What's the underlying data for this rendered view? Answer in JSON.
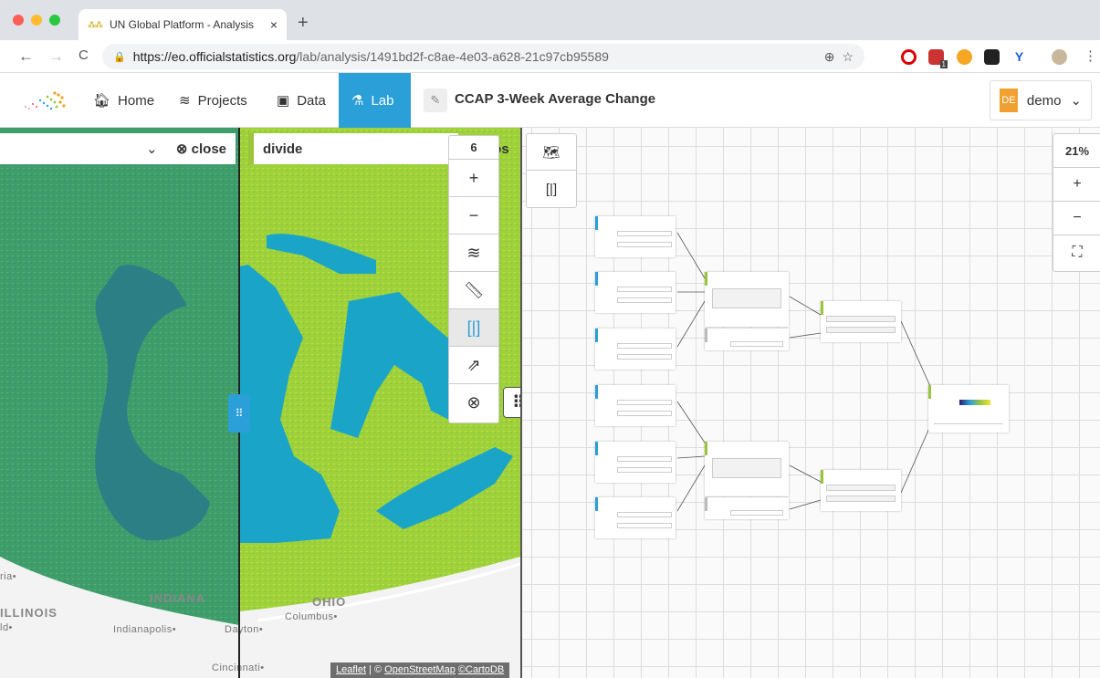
{
  "browser": {
    "tab_title": "UN Global Platform - Analysis",
    "tab_close": "×",
    "new_tab": "+",
    "url_host": "https://eo.officialstatistics.org",
    "url_path": "/lab/analysis/1491bd2f-c8ae-4e03-a628-21c97cb95589",
    "back": "←",
    "forward": "→",
    "reload": "C",
    "menu": "⋮",
    "ext_badge": "1"
  },
  "nav": {
    "items": [
      {
        "label": "Home",
        "icon": "home-icon"
      },
      {
        "label": "Projects",
        "icon": "layers-icon"
      },
      {
        "label": "Data",
        "icon": "database-icon"
      },
      {
        "label": "Lab",
        "icon": "lab-icon"
      }
    ],
    "active": "Lab",
    "analysis_title": "CCAP 3-Week Average Change",
    "user_initials": "DE",
    "user_name": "demo",
    "user_chevron": "⌄"
  },
  "map": {
    "left_selector": {
      "value": "",
      "close_label": "close"
    },
    "right_selector": {
      "value": "divide",
      "close_label": "los"
    },
    "zoom_level": "6",
    "zoom_in": "+",
    "zoom_out": "−",
    "attribution": {
      "leaflet": "Leaflet",
      "osm": "OpenStreetMap",
      "carto": "©CartoDB",
      "sep": " | © "
    },
    "places": [
      "ria•",
      "INDIANA",
      "OHIO",
      "Columbus•",
      "ILLINOIS",
      "ld•",
      "Indianapolis•",
      "Dayton•",
      "Cincinnati•"
    ]
  },
  "graph": {
    "zoom_percent": "21%",
    "zoom_in": "+",
    "zoom_out": "−"
  },
  "colors": {
    "accent": "#2a9fd8",
    "op": "#9ac53d",
    "avatar": "#f0a030",
    "water": "#1aa5c8"
  }
}
